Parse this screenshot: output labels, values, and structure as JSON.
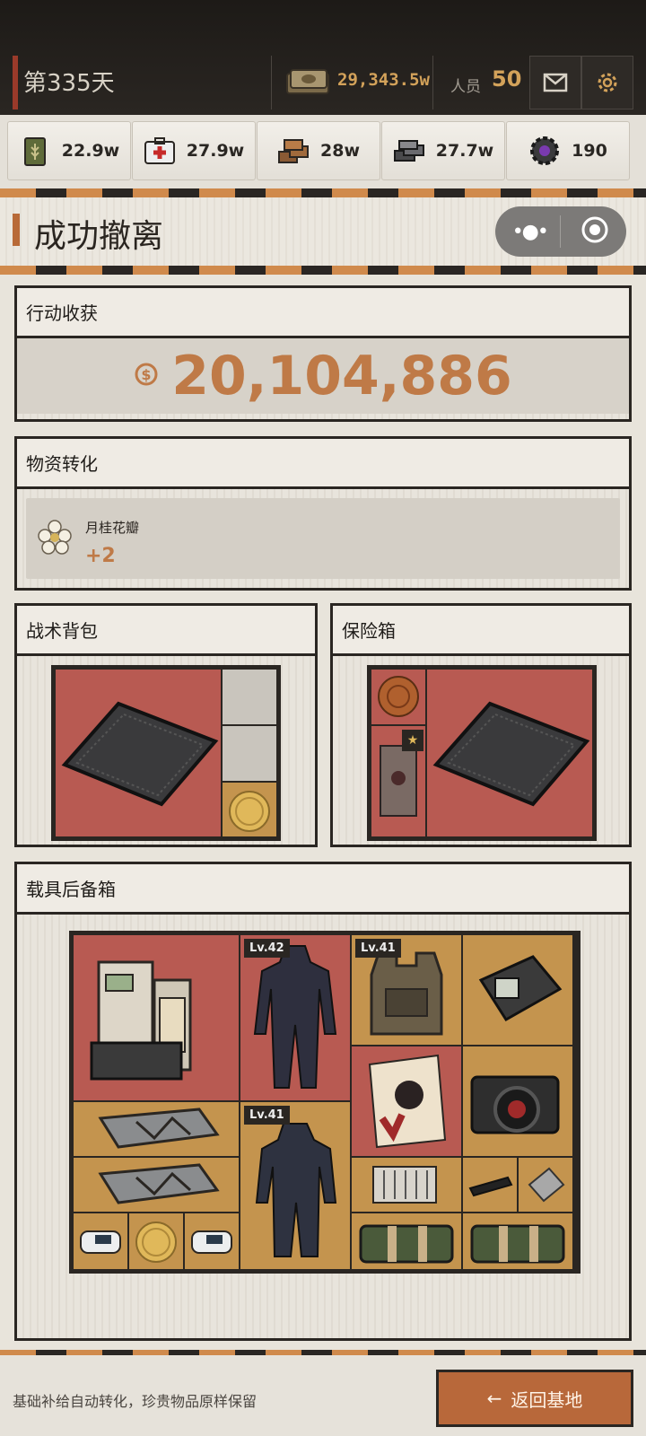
{
  "header": {
    "day": "第335天",
    "money": "29,343.5w",
    "staff_label": "人员",
    "staff": "50"
  },
  "resources": [
    {
      "name": "粮食",
      "value": "22.9w",
      "icon": "grain-can-icon"
    },
    {
      "name": "药品",
      "value": "27.9w",
      "icon": "medkit-icon"
    },
    {
      "name": "木材",
      "value": "28w",
      "icon": "wood-icon"
    },
    {
      "name": "钢材",
      "value": "27.7w",
      "icon": "steel-icon"
    },
    {
      "name": "零件",
      "value": "190",
      "icon": "gear-part-icon"
    }
  ],
  "page": {
    "title": "成功撤离"
  },
  "earnings": {
    "title": "行动收获",
    "value": "20,104,886",
    "currency_symbol": "$"
  },
  "conversion": {
    "title": "物资转化",
    "item_name": "月桂花瓣",
    "item_delta": "+2"
  },
  "backpack": {
    "title": "战术背包"
  },
  "safebox": {
    "title": "保险箱"
  },
  "vehicle": {
    "title": "载具后备箱",
    "levels": [
      "Lv.42",
      "Lv.41",
      "Lv.41"
    ]
  },
  "footer": {
    "tip": "基础补给自动转化，珍贵物品原样保留",
    "back_label": "返回基地",
    "back_arrow": "←"
  },
  "colors": {
    "accent": "#bf7a47",
    "red_cell": "#b85a52",
    "gold_cell": "#c4944e",
    "dark": "#2a2622"
  }
}
